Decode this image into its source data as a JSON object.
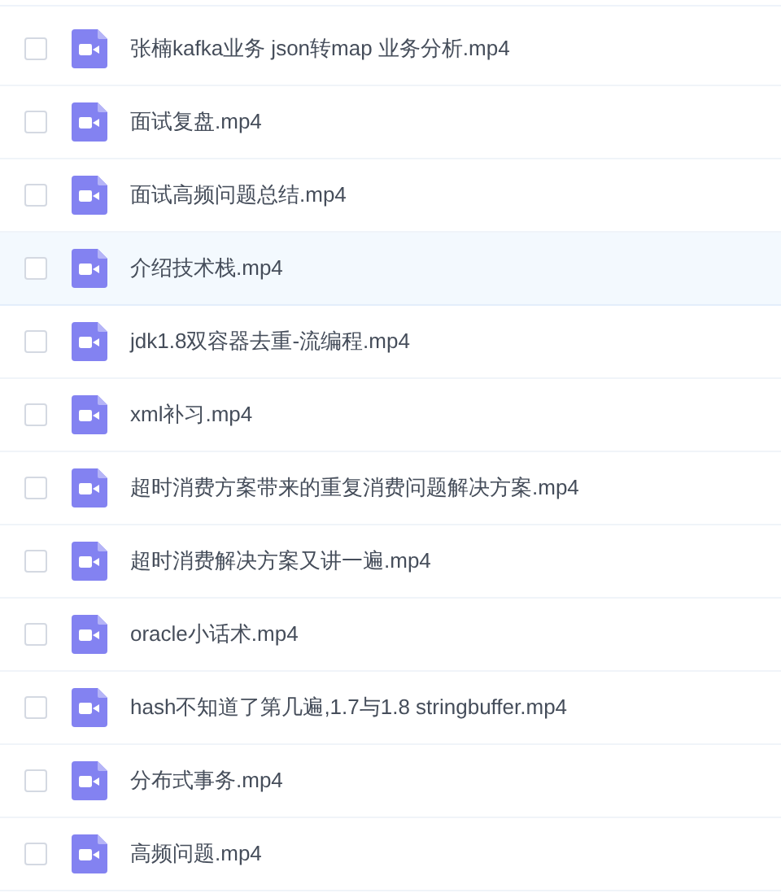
{
  "files": [
    {
      "name": "张楠kafka业务 json转map 业务分析.mp4",
      "checked": false,
      "selected": false
    },
    {
      "name": "面试复盘.mp4",
      "checked": false,
      "selected": false
    },
    {
      "name": "面试高频问题总结.mp4",
      "checked": false,
      "selected": false
    },
    {
      "name": "介绍技术栈.mp4",
      "checked": false,
      "selected": true
    },
    {
      "name": "jdk1.8双容器去重-流编程.mp4",
      "checked": false,
      "selected": false
    },
    {
      "name": "xml补习.mp4",
      "checked": false,
      "selected": false
    },
    {
      "name": "超时消费方案带来的重复消费问题解决方案.mp4",
      "checked": false,
      "selected": false
    },
    {
      "name": "超时消费解决方案又讲一遍.mp4",
      "checked": false,
      "selected": false
    },
    {
      "name": "oracle小话术.mp4",
      "checked": false,
      "selected": false
    },
    {
      "name": "hash不知道了第几遍,1.7与1.8 stringbuffer.mp4",
      "checked": false,
      "selected": false
    },
    {
      "name": "分布式事务.mp4",
      "checked": false,
      "selected": false
    },
    {
      "name": "高频问题.mp4",
      "checked": false,
      "selected": false
    }
  ]
}
